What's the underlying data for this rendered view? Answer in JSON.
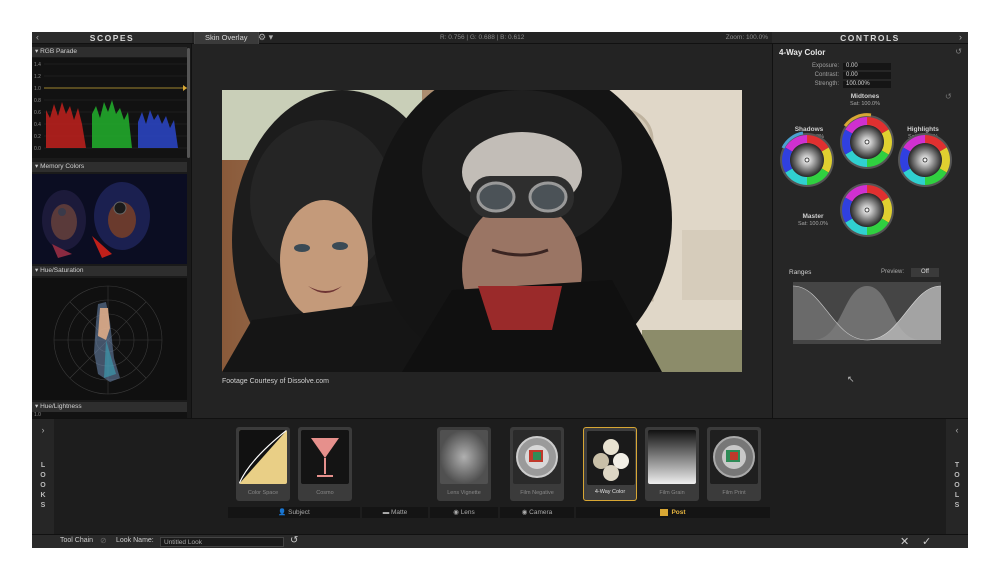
{
  "scopes": {
    "title": "SCOPES",
    "sections": [
      "RGB Parade",
      "Memory Colors",
      "Hue/Saturation",
      "Hue/Lightness"
    ],
    "parade_ticks": [
      "1.4",
      "1.2",
      "1.0",
      "0.8",
      "0.6",
      "0.4",
      "0.2",
      "0.0"
    ],
    "lightness_tick": "1.0"
  },
  "viewer": {
    "tab": "Skin Overlay",
    "gear": "⚙ ▾",
    "readout": "R: 0.756 | G: 0.688 | B: 0.612",
    "zoom": "Zoom: 100.0%",
    "caption": "Footage Courtesy of Dissolve.com"
  },
  "controls": {
    "title": "CONTROLS",
    "tool_title": "4-Way Color",
    "exposure_label": "Exposure:",
    "exposure": "0.00",
    "contrast_label": "Contrast:",
    "contrast": "0.00",
    "strength_label": "Strength:",
    "strength": "100.00%",
    "midtones": "Midtones",
    "midtones_sat": "Sat: 100.0%",
    "shadows": "Shadows",
    "shadows_sat": "Sat: 100.0%",
    "highlights": "Highlights",
    "highlights_sat": "Sat: 100.0%",
    "master": "Master",
    "master_sat": "Sat: 100.0%",
    "ranges": "Ranges",
    "preview_label": "Preview:",
    "preview_value": "Off"
  },
  "looks": {
    "looks_tab": [
      "L",
      "O",
      "O",
      "K",
      "S"
    ],
    "tools_tab": [
      "T",
      "O",
      "O",
      "L",
      "S"
    ],
    "thumbs": [
      "Color Space",
      "Cosmo",
      "Lens Vignette",
      "Film Negative",
      "4-Way Color",
      "Film Grain",
      "Film Print"
    ],
    "categories": [
      "Subject",
      "Matte",
      "Lens",
      "Camera",
      "Post"
    ]
  },
  "status": {
    "tool_chain": "Tool Chain",
    "look_name_label": "Look Name:",
    "look_name_value": "Untitled Look"
  },
  "colors": {
    "accent": "#d8a734",
    "panel": "#262626"
  }
}
